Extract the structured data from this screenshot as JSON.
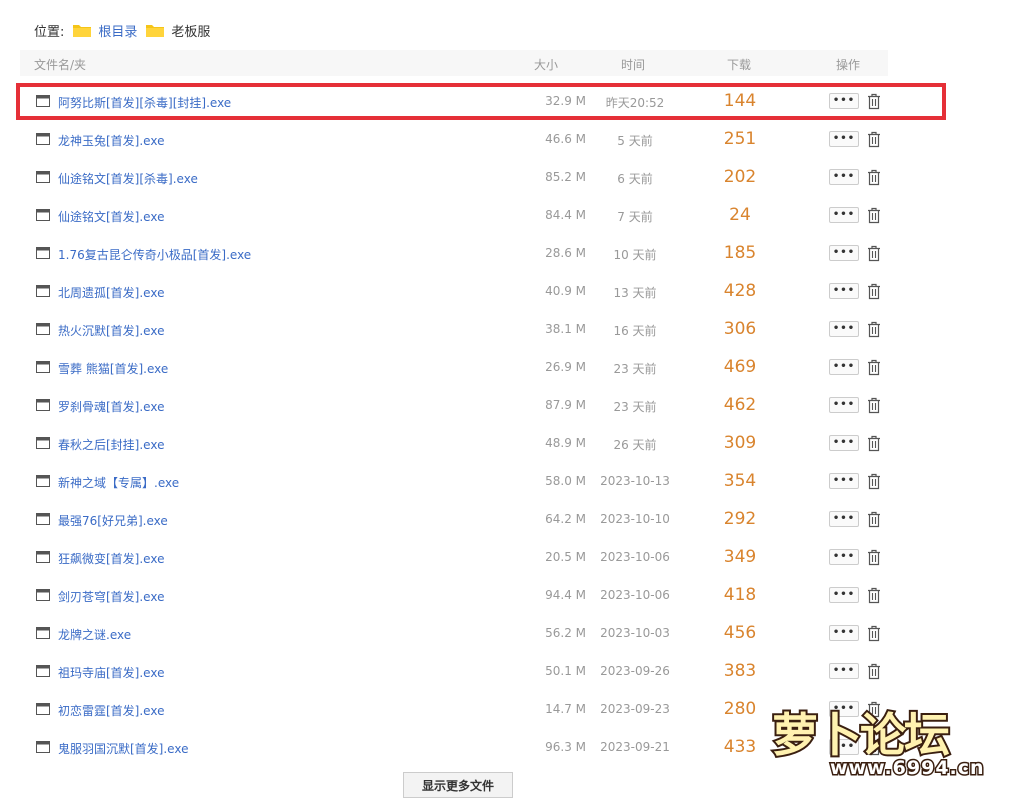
{
  "breadcrumb": {
    "prefix": "位置:",
    "root": "根目录",
    "current": "老板服"
  },
  "header": {
    "name": "文件名/夹",
    "size": "大小",
    "time": "时间",
    "downloads": "下载",
    "actions": "操作"
  },
  "files": [
    {
      "name": "阿努比斯[首发][杀毒][封挂].exe",
      "size": "32.9 M",
      "time": "昨天20:52",
      "downloads": "144"
    },
    {
      "name": "龙神玉兔[首发].exe",
      "size": "46.6 M",
      "time": "5 天前",
      "downloads": "251"
    },
    {
      "name": "仙途铭文[首发][杀毒].exe",
      "size": "85.2 M",
      "time": "6 天前",
      "downloads": "202"
    },
    {
      "name": "仙途铭文[首发].exe",
      "size": "84.4 M",
      "time": "7 天前",
      "downloads": "24"
    },
    {
      "name": "1.76复古昆仑传奇小极品[首发].exe",
      "size": "28.6 M",
      "time": "10 天前",
      "downloads": "185"
    },
    {
      "name": "北周遗孤[首发].exe",
      "size": "40.9 M",
      "time": "13 天前",
      "downloads": "428"
    },
    {
      "name": "热火沉默[首发].exe",
      "size": "38.1 M",
      "time": "16 天前",
      "downloads": "306"
    },
    {
      "name": "雪葬 熊猫[首发].exe",
      "size": "26.9 M",
      "time": "23 天前",
      "downloads": "469"
    },
    {
      "name": "罗刹骨魂[首发].exe",
      "size": "87.9 M",
      "time": "23 天前",
      "downloads": "462"
    },
    {
      "name": "春秋之后[封挂].exe",
      "size": "48.9 M",
      "time": "26 天前",
      "downloads": "309"
    },
    {
      "name": "新神之域【专属】.exe",
      "size": "58.0 M",
      "time": "2023-10-13",
      "downloads": "354"
    },
    {
      "name": "最强76[好兄弟].exe",
      "size": "64.2 M",
      "time": "2023-10-10",
      "downloads": "292"
    },
    {
      "name": "狂飙微变[首发].exe",
      "size": "20.5 M",
      "time": "2023-10-06",
      "downloads": "349"
    },
    {
      "name": "剑刃苍穹[首发].exe",
      "size": "94.4 M",
      "time": "2023-10-06",
      "downloads": "418"
    },
    {
      "name": "龙牌之谜.exe",
      "size": "56.2 M",
      "time": "2023-10-03",
      "downloads": "456"
    },
    {
      "name": "祖玛寺庙[首发].exe",
      "size": "50.1 M",
      "time": "2023-09-26",
      "downloads": "383"
    },
    {
      "name": "初恋雷霆[首发].exe",
      "size": "14.7 M",
      "time": "2023-09-23",
      "downloads": "280"
    },
    {
      "name": "鬼服羽国沉默[首发].exe",
      "size": "96.3 M",
      "time": "2023-09-21",
      "downloads": "433"
    }
  ],
  "more_button_label": "•••",
  "show_more_label": "显示更多文件",
  "watermark": {
    "logo_text": "萝卜论坛",
    "url": "www.6994.cn"
  },
  "colors": {
    "link": "#3a6bc6",
    "downloads": "#d9842e",
    "highlight_border": "#e52f37",
    "folder": "#f5c518"
  }
}
